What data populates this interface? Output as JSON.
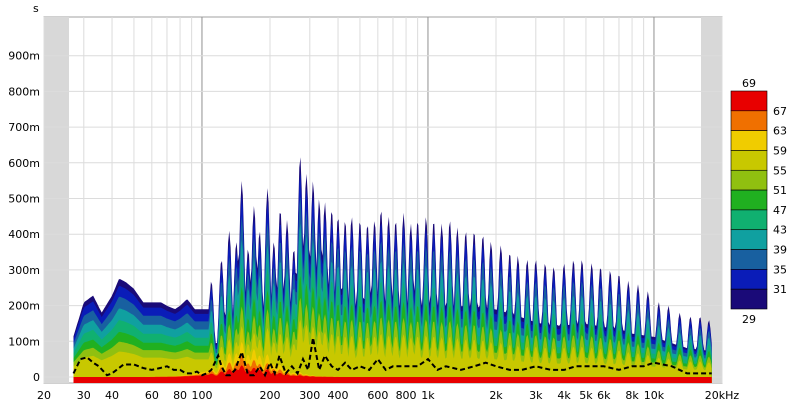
{
  "chart_data": {
    "type": "heatmap",
    "subtype": "spectrogram-waterfall",
    "title": "",
    "y_unit_label": "s",
    "x_unit_label": "kHz",
    "x_scale": "log",
    "xlim": [
      20,
      20000
    ],
    "ylim": [
      0,
      1.0
    ],
    "x_ticks": [
      {
        "value": 20,
        "label": "20"
      },
      {
        "value": 30,
        "label": "30"
      },
      {
        "value": 40,
        "label": "40"
      },
      {
        "value": 60,
        "label": "60"
      },
      {
        "value": 80,
        "label": "80"
      },
      {
        "value": 100,
        "label": "100"
      },
      {
        "value": 200,
        "label": "200"
      },
      {
        "value": 300,
        "label": "300"
      },
      {
        "value": 400,
        "label": "400"
      },
      {
        "value": 600,
        "label": "600"
      },
      {
        "value": 800,
        "label": "800"
      },
      {
        "value": 1000,
        "label": "1k"
      },
      {
        "value": 2000,
        "label": "2k"
      },
      {
        "value": 3000,
        "label": "3k"
      },
      {
        "value": 4000,
        "label": "4k"
      },
      {
        "value": 5000,
        "label": "5k"
      },
      {
        "value": 6000,
        "label": "6k"
      },
      {
        "value": 8000,
        "label": "8k"
      },
      {
        "value": 10000,
        "label": "10k"
      },
      {
        "value": 20000,
        "label": "20kHz"
      }
    ],
    "y_ticks": [
      {
        "value": 0,
        "label": "0"
      },
      {
        "value": 0.1,
        "label": "100m"
      },
      {
        "value": 0.2,
        "label": "200m"
      },
      {
        "value": 0.3,
        "label": "300m"
      },
      {
        "value": 0.4,
        "label": "400m"
      },
      {
        "value": 0.5,
        "label": "500m"
      },
      {
        "value": 0.6,
        "label": "600m"
      },
      {
        "value": 0.7,
        "label": "700m"
      },
      {
        "value": 0.8,
        "label": "800m"
      },
      {
        "value": 0.9,
        "label": "900m"
      }
    ],
    "colorbar": {
      "min_label": "29",
      "max_label": "69",
      "levels": [
        {
          "value": 31,
          "color": "#1a0a78"
        },
        {
          "value": 35,
          "color": "#0a1cb8"
        },
        {
          "value": 39,
          "color": "#1860a0"
        },
        {
          "value": 43,
          "color": "#10a0a0"
        },
        {
          "value": 47,
          "color": "#10b070"
        },
        {
          "value": 51,
          "color": "#20b020"
        },
        {
          "value": 55,
          "color": "#90c010"
        },
        {
          "value": 59,
          "color": "#c8c800"
        },
        {
          "value": 63,
          "color": "#f0cc00"
        },
        {
          "value": 67,
          "color": "#f07000"
        },
        {
          "value": 69,
          "color": "#e80000"
        }
      ]
    },
    "decay_envelope": {
      "x": [
        27,
        30,
        33,
        36,
        40,
        43,
        46,
        50,
        55,
        60,
        66,
        70,
        76,
        80,
        86,
        93,
        100,
        110,
        120,
        130,
        138,
        147,
        155,
        165,
        175,
        185,
        200,
        215,
        230,
        250,
        270,
        285,
        300,
        320,
        345,
        370,
        400,
        430,
        460,
        500,
        550,
        600,
        650,
        700,
        750,
        800,
        900,
        1000,
        1200,
        1500,
        2000,
        2500,
        3000,
        3500,
        4000,
        4500,
        5000,
        5500,
        6000,
        7000,
        8000,
        10000,
        12000,
        14000,
        16000,
        18000
      ],
      "y": [
        0.12,
        0.22,
        0.24,
        0.19,
        0.24,
        0.29,
        0.28,
        0.26,
        0.22,
        0.22,
        0.22,
        0.21,
        0.2,
        0.21,
        0.23,
        0.2,
        0.2,
        0.2,
        0.22,
        0.41,
        0.38,
        0.55,
        0.36,
        0.41,
        0.44,
        0.38,
        0.53,
        0.32,
        0.44,
        0.47,
        0.36,
        0.64,
        0.57,
        0.55,
        0.52,
        0.49,
        0.47,
        0.45,
        0.45,
        0.44,
        0.43,
        0.44,
        0.47,
        0.45,
        0.44,
        0.46,
        0.44,
        0.45,
        0.44,
        0.44,
        0.42,
        0.38,
        0.34,
        0.32,
        0.32,
        0.33,
        0.33,
        0.32,
        0.31,
        0.3,
        0.27,
        0.25,
        0.21,
        0.18,
        0.17,
        0.16
      ]
    },
    "peak_ridges": {
      "x": [
        110,
        122,
        132,
        142,
        150,
        160,
        170,
        180,
        195,
        208,
        222,
        238,
        255,
        272,
        290,
        310,
        330,
        350,
        375,
        400,
        430,
        460,
        500,
        540,
        580,
        620,
        670,
        720,
        780,
        840,
        900,
        980,
        1060,
        1150,
        1250,
        1350,
        1470,
        1600,
        1750,
        1900,
        2100,
        2300,
        2500,
        2750,
        3000,
        3300,
        3600,
        4000,
        4400,
        4800,
        5300,
        5800,
        6400,
        7000,
        7700,
        8500,
        9400,
        10500,
        11600,
        13000,
        14500,
        16000,
        17500
      ],
      "y": [
        0.27,
        0.33,
        0.41,
        0.38,
        0.55,
        0.36,
        0.48,
        0.41,
        0.53,
        0.38,
        0.47,
        0.44,
        0.36,
        0.62,
        0.57,
        0.55,
        0.5,
        0.49,
        0.47,
        0.45,
        0.44,
        0.45,
        0.44,
        0.43,
        0.44,
        0.47,
        0.45,
        0.44,
        0.46,
        0.43,
        0.44,
        0.45,
        0.44,
        0.43,
        0.44,
        0.42,
        0.41,
        0.41,
        0.4,
        0.38,
        0.37,
        0.35,
        0.34,
        0.33,
        0.33,
        0.32,
        0.31,
        0.32,
        0.33,
        0.33,
        0.32,
        0.31,
        0.3,
        0.29,
        0.27,
        0.26,
        0.24,
        0.21,
        0.2,
        0.18,
        0.17,
        0.17,
        0.16
      ]
    },
    "rt_dashed_line": {
      "x": [
        27,
        29,
        31,
        33,
        35,
        38,
        40,
        45,
        50,
        55,
        60,
        65,
        70,
        75,
        80,
        85,
        90,
        95,
        100,
        105,
        110,
        118,
        122,
        128,
        133,
        140,
        150,
        160,
        170,
        180,
        190,
        200,
        210,
        220,
        235,
        250,
        265,
        280,
        295,
        310,
        330,
        350,
        375,
        400,
        430,
        460,
        500,
        550,
        600,
        650,
        700,
        800,
        900,
        1000,
        1100,
        1200,
        1400,
        1600,
        1800,
        2000,
        2300,
        2600,
        3000,
        3500,
        4000,
        4500,
        5000,
        6000,
        7000,
        8000,
        9000,
        10000,
        12000,
        14000,
        16000,
        18000
      ],
      "y": [
        0.01,
        0.05,
        0.055,
        0.04,
        0.03,
        0.005,
        0.01,
        0.035,
        0.035,
        0.025,
        0.02,
        0.025,
        0.03,
        0.02,
        0.02,
        0.01,
        0.01,
        0.015,
        0.005,
        0.01,
        0.02,
        0.06,
        0.03,
        0.005,
        0.005,
        0.02,
        0.07,
        0.005,
        0.005,
        0.03,
        0.005,
        0.04,
        0.01,
        0.06,
        0.01,
        0.03,
        0.01,
        0.05,
        0.02,
        0.11,
        0.02,
        0.06,
        0.03,
        0.02,
        0.04,
        0.02,
        0.03,
        0.02,
        0.05,
        0.02,
        0.03,
        0.03,
        0.03,
        0.05,
        0.02,
        0.03,
        0.02,
        0.03,
        0.04,
        0.03,
        0.02,
        0.02,
        0.03,
        0.02,
        0.02,
        0.03,
        0.03,
        0.03,
        0.02,
        0.03,
        0.03,
        0.04,
        0.03,
        0.01,
        0.01,
        0.01
      ]
    }
  }
}
